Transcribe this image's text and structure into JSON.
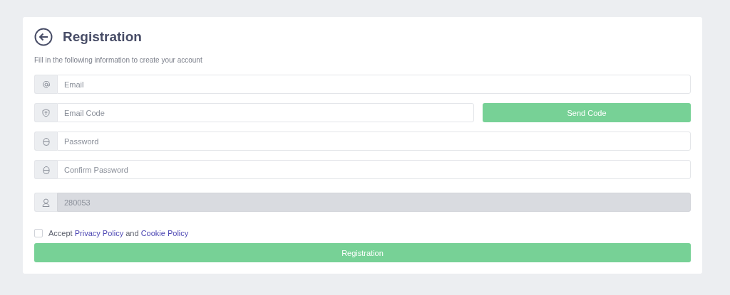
{
  "header": {
    "title": "Registration",
    "subtitle": "Fill in the following information to create your account"
  },
  "fields": [
    {
      "placeholder": "Email",
      "disabled": false
    },
    {
      "placeholder": "Email Code",
      "disabled": false,
      "button": "Send Code"
    },
    {
      "placeholder": "Password",
      "disabled": false
    },
    {
      "placeholder": "Confirm Password",
      "disabled": false
    },
    {
      "value": "280053",
      "disabled": true
    }
  ],
  "agreement": {
    "checked": false,
    "parts": [
      {
        "kind": "text",
        "text": "Accept"
      },
      {
        "kind": "link",
        "text": "Privacy Policy"
      },
      {
        "kind": "text",
        "text": "and"
      },
      {
        "kind": "link",
        "text": "Cookie Policy"
      }
    ]
  },
  "submit": "Registration"
}
